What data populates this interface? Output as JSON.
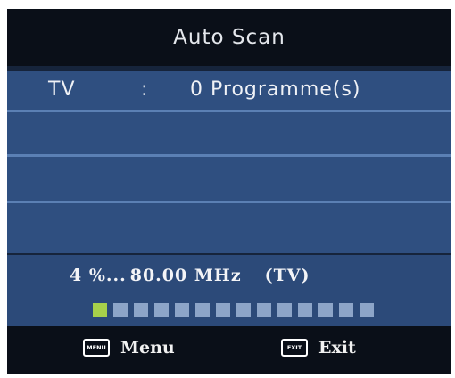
{
  "title": "Auto Scan",
  "channel_row": {
    "label": "TV",
    "separator": ":",
    "count": "0",
    "unit": "Programme(s)"
  },
  "scan": {
    "percent_text": "4 %...",
    "frequency": "80.00 MHz",
    "band": "(TV)",
    "progress_segments_total": 14,
    "progress_segments_filled": 1,
    "colors": {
      "filled": "#a8d14a",
      "empty": "#8da5c8"
    }
  },
  "footer": {
    "menu_key_icon": "MENU",
    "menu_label": "Menu",
    "exit_key_icon": "EXIT",
    "exit_label": "Exit"
  }
}
